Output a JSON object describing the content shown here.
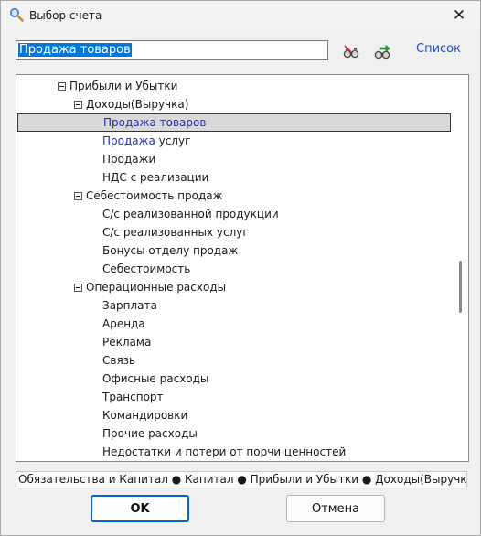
{
  "window": {
    "title": "Выбор счета",
    "close_glyph": "✕",
    "icon": "magnifier-icon"
  },
  "toolbar": {
    "search_value": "Продажа товаров",
    "button1_icon": "find-icon",
    "button2_icon": "find-next-icon",
    "list_link": "Список"
  },
  "tree": {
    "rows": [
      {
        "label": "Прибыли и Убытки",
        "toggle": true,
        "match": "",
        "rest": "Прибыли и Убытки",
        "selected": false
      },
      {
        "label": "Доходы(Выручка)",
        "toggle": true,
        "match": "",
        "rest": "Доходы(Выручка)",
        "selected": false
      },
      {
        "label": "Продажа товаров",
        "toggle": false,
        "match": "Продажа товаров",
        "rest": "",
        "selected": true
      },
      {
        "label": "Продажа услуг",
        "toggle": false,
        "match": "Продажа",
        "rest": " услуг",
        "selected": false
      },
      {
        "label": "Продажи",
        "toggle": false,
        "match": "",
        "rest": "Продажи",
        "selected": false
      },
      {
        "label": "НДС с реализации",
        "toggle": false,
        "match": "",
        "rest": "НДС с реализации",
        "selected": false
      },
      {
        "label": "Себестоимость продаж",
        "toggle": true,
        "match": "",
        "rest": "Себестоимость продаж",
        "selected": false
      },
      {
        "label": "С/с реализованной продукции",
        "toggle": false,
        "match": "",
        "rest": "С/с реализованной продукции",
        "selected": false
      },
      {
        "label": "С/с реализованных услуг",
        "toggle": false,
        "match": "",
        "rest": "С/с реализованных услуг",
        "selected": false
      },
      {
        "label": "Бонусы отделу продаж",
        "toggle": false,
        "match": "",
        "rest": "Бонусы отделу продаж",
        "selected": false
      },
      {
        "label": "Себестоимость",
        "toggle": false,
        "match": "",
        "rest": "Себестоимость",
        "selected": false
      },
      {
        "label": "Операционные расходы",
        "toggle": true,
        "match": "",
        "rest": "Операционные расходы",
        "selected": false
      },
      {
        "label": "Зарплата",
        "toggle": false,
        "match": "",
        "rest": "Зарплата",
        "selected": false
      },
      {
        "label": "Аренда",
        "toggle": false,
        "match": "",
        "rest": "Аренда",
        "selected": false
      },
      {
        "label": "Реклама",
        "toggle": false,
        "match": "",
        "rest": "Реклама",
        "selected": false
      },
      {
        "label": "Связь",
        "toggle": false,
        "match": "",
        "rest": "Связь",
        "selected": false
      },
      {
        "label": "Офисные расходы",
        "toggle": false,
        "match": "",
        "rest": "Офисные расходы",
        "selected": false
      },
      {
        "label": "Транспорт",
        "toggle": false,
        "match": "",
        "rest": "Транспорт",
        "selected": false
      },
      {
        "label": "Командировки",
        "toggle": false,
        "match": "",
        "rest": "Командировки",
        "selected": false
      },
      {
        "label": "Прочие расходы",
        "toggle": false,
        "match": "",
        "rest": "Прочие расходы",
        "selected": false
      },
      {
        "label": "Недостатки и потери от порчи ценностей",
        "toggle": false,
        "match": "",
        "rest": "Недостатки и потери от порчи ценностей",
        "selected": false
      }
    ]
  },
  "breadcrumb": "Обязательства и Капитал ● Капитал ● Прибыли и Убытки ● Доходы(Выручка",
  "buttons": {
    "ok": "OK",
    "cancel": "Отмена"
  },
  "colors": {
    "accent": "#0067c0",
    "link": "#1f4ec9",
    "match": "#1f2fb8",
    "selection_bg": "#d9d9d9",
    "input_highlight": "#0078d7"
  }
}
